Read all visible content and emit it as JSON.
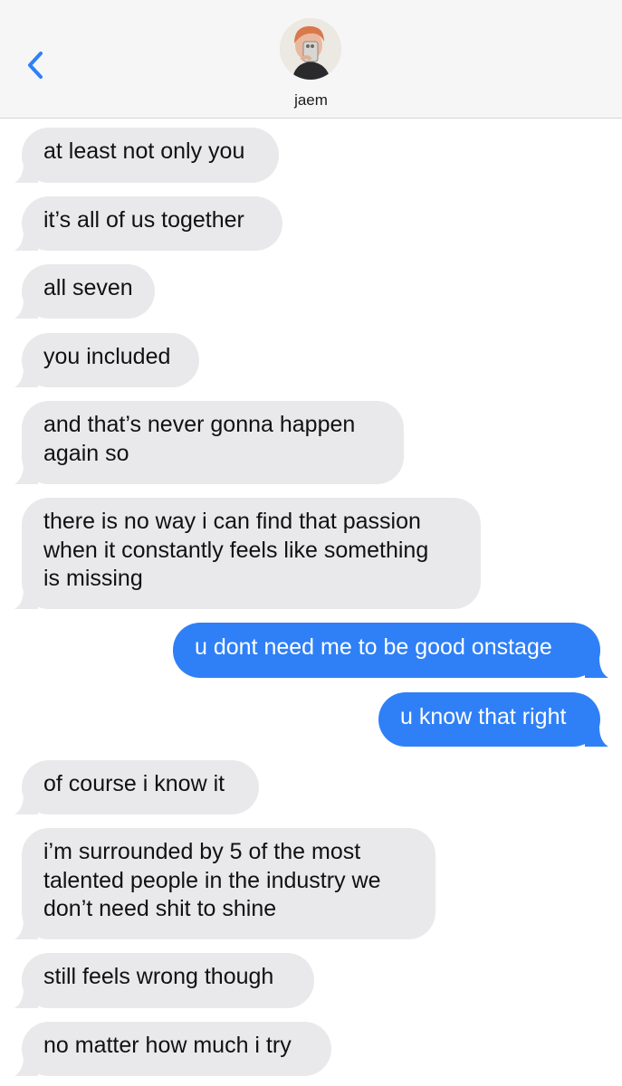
{
  "header": {
    "contact_name": "jaem",
    "back_icon": "chevron-left-icon",
    "accent_color": "#2f80f7"
  },
  "messages": [
    {
      "from": "them",
      "text": "at least not only you"
    },
    {
      "from": "them",
      "text": "it’s all of us together"
    },
    {
      "from": "them",
      "text": "all seven"
    },
    {
      "from": "them",
      "text": "you included"
    },
    {
      "from": "them",
      "text": "and that’s never gonna happen\nagain so"
    },
    {
      "from": "them",
      "text": "there is no way i can find that passion\nwhen it constantly feels like something\nis missing"
    },
    {
      "from": "me",
      "text": "u dont need me to be good onstage"
    },
    {
      "from": "me",
      "text": "u know that right"
    },
    {
      "from": "them",
      "text": "of course i know it"
    },
    {
      "from": "them",
      "text": "i’m surrounded by 5 of the most\ntalented people in the industry we\ndon’t need shit to shine"
    },
    {
      "from": "them",
      "text": "still feels wrong though"
    },
    {
      "from": "them",
      "text": "no matter how much i try"
    }
  ],
  "colors": {
    "incoming_bubble": "#e9e9eb",
    "outgoing_bubble": "#2f80f7",
    "header_bg": "#f6f6f7"
  }
}
